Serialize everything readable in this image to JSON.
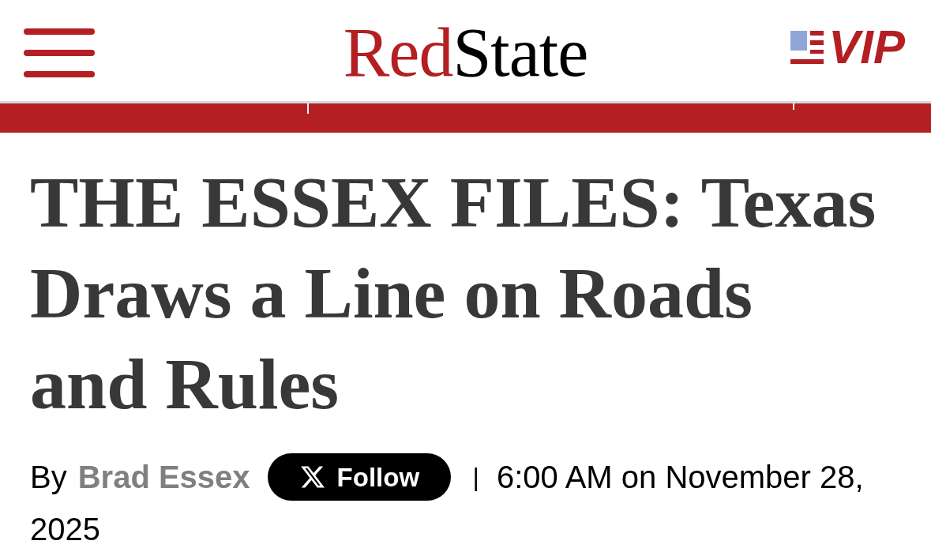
{
  "header": {
    "logo": [
      {
        "text": "Red",
        "color": "#b41f24"
      },
      {
        "text": "State",
        "color": "#000000"
      }
    ],
    "vip_link": {
      "label": "VIP"
    }
  },
  "article": {
    "headline": {
      "lines": [
        "THE ESSEX FILES: Texas",
        "Draws a Line on Roads",
        "and Rules"
      ]
    },
    "byline": {
      "prefix": "By",
      "author": "Brad Essex",
      "follow_button": {
        "label": "Follow"
      },
      "separator": "|",
      "timestamp_lines": [
        "6:00 AM on November 28,",
        "2025"
      ]
    }
  }
}
